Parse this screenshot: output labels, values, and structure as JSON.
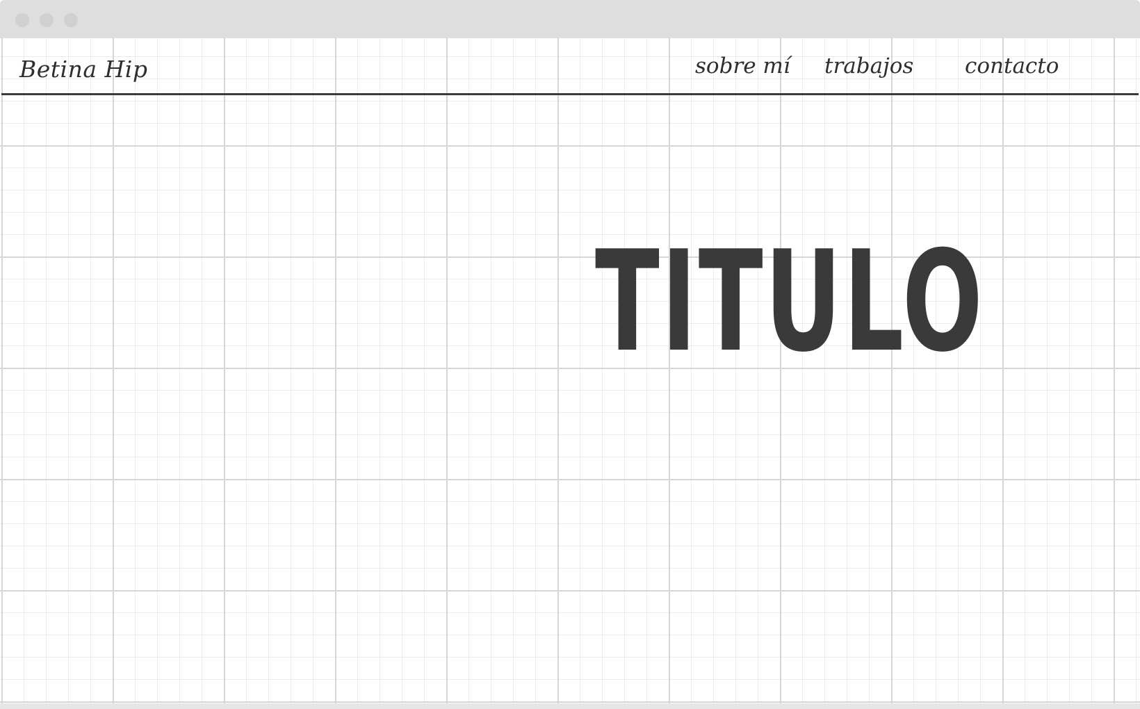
{
  "window": {
    "controls": [
      "close-dot",
      "minimize-dot",
      "zoom-dot"
    ]
  },
  "header": {
    "brand": "Betina Hip",
    "nav": {
      "about": "sobre mí",
      "works": "trabajos",
      "contact": "contacto"
    }
  },
  "hero": {
    "title": "TITULO"
  },
  "colors": {
    "ink": "#3a3a3a",
    "titlebar": "#dedede",
    "grid_major": "#d6d6d6",
    "grid_minor": "#ebebeb",
    "background": "#ffffff"
  }
}
